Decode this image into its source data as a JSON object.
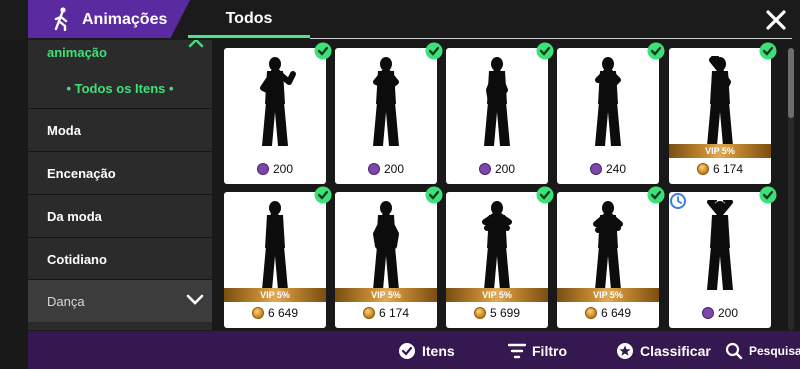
{
  "header": {
    "animations_tab": "Animações",
    "all_tab": "Todos"
  },
  "sidebar": {
    "section_title": "animação",
    "all_items": "•  Todos os Itens  •",
    "items": [
      {
        "label": "Moda"
      },
      {
        "label": "Encenação"
      },
      {
        "label": "Da moda"
      },
      {
        "label": "Cotidiano"
      },
      {
        "label": "Dança"
      }
    ]
  },
  "grid": {
    "items": [
      {
        "price": "200",
        "currency": "vip-coin",
        "vip": "",
        "owned": true
      },
      {
        "price": "200",
        "currency": "vip-coin",
        "vip": "",
        "owned": true
      },
      {
        "price": "200",
        "currency": "vip-coin",
        "vip": "",
        "owned": true
      },
      {
        "price": "240",
        "currency": "vip-coin",
        "vip": "",
        "owned": true
      },
      {
        "price": "6 174",
        "currency": "gold-coin",
        "vip": "VIP 5%",
        "owned": true
      },
      {
        "price": "6 649",
        "currency": "gold-coin",
        "vip": "VIP 5%",
        "owned": true
      },
      {
        "price": "6 174",
        "currency": "gold-coin",
        "vip": "VIP 5%",
        "owned": true
      },
      {
        "price": "5 699",
        "currency": "gold-coin",
        "vip": "VIP 5%",
        "owned": true
      },
      {
        "price": "6 649",
        "currency": "gold-coin",
        "vip": "VIP 5%",
        "owned": true
      },
      {
        "price": "200",
        "currency": "vip-coin",
        "vip": "",
        "owned": true,
        "timed": true
      }
    ]
  },
  "bottom": {
    "items": "Itens",
    "filter": "Filtro",
    "sort": "Classificar",
    "search": "Pesquisa"
  },
  "colors": {
    "accent_green": "#3fe07a",
    "purple": "#5a2aa0",
    "bottom_bar": "#35184f"
  }
}
